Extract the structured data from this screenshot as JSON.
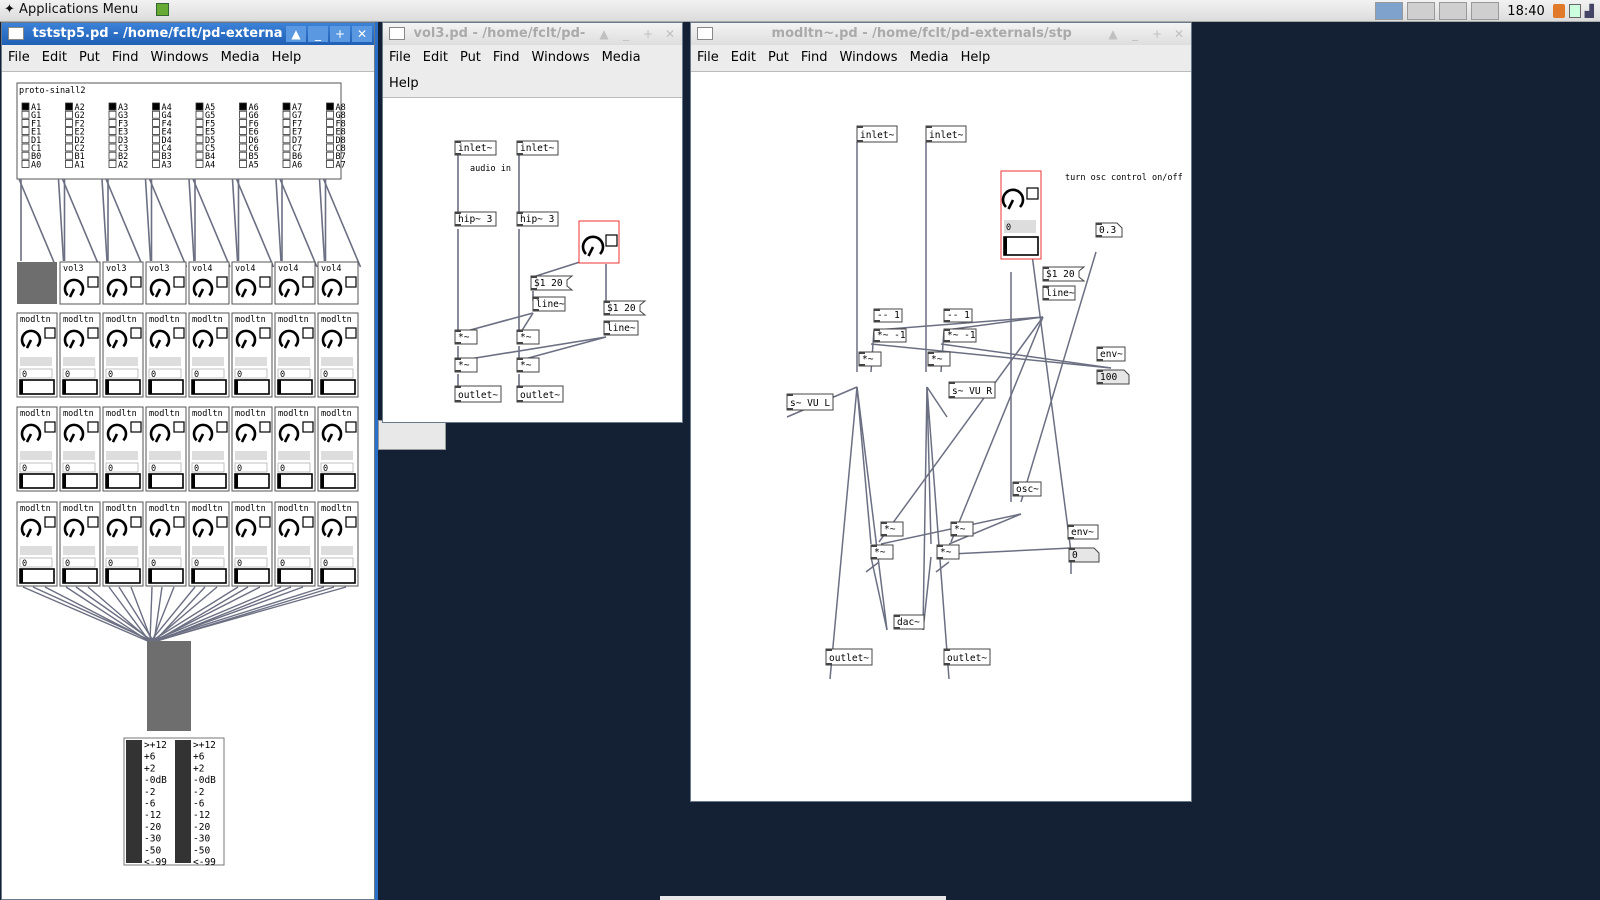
{
  "top_panel": {
    "apps_label": "Applications Menu",
    "clock": "18:40"
  },
  "menu_labels": [
    "File",
    "Edit",
    "Put",
    "Find",
    "Windows",
    "Media",
    "Help"
  ],
  "win_buttons": [
    "▲",
    "_",
    "+",
    "✕"
  ],
  "window1": {
    "title": "tststp5.pd  - /home/fclt/pd-externa",
    "proto_label": "proto-sinall2",
    "radio_columns": [
      [
        "A1",
        "G1",
        "F1",
        "E1",
        "D1",
        "C1",
        "B0",
        "A0"
      ],
      [
        "A2",
        "G2",
        "F2",
        "E2",
        "D2",
        "C2",
        "B1",
        "A1"
      ],
      [
        "A3",
        "G3",
        "F3",
        "E3",
        "D3",
        "C3",
        "B2",
        "A2"
      ],
      [
        "A4",
        "G4",
        "F4",
        "E4",
        "D4",
        "C4",
        "B3",
        "A3"
      ],
      [
        "A5",
        "G5",
        "F5",
        "E5",
        "D5",
        "C5",
        "B4",
        "A4"
      ],
      [
        "A6",
        "G6",
        "F6",
        "E6",
        "D6",
        "C6",
        "B5",
        "A5"
      ],
      [
        "A7",
        "G7",
        "F7",
        "E7",
        "D7",
        "C7",
        "B6",
        "A6"
      ],
      [
        "A8",
        "G8",
        "F8",
        "E8",
        "D8",
        "C8",
        "B7",
        "A7"
      ]
    ],
    "vol_labels": [
      "",
      "vol3",
      "vol3",
      "vol3",
      "vol4",
      "vol4",
      "vol4",
      "vol4"
    ],
    "modltn_label": "modltn",
    "number_value": "0",
    "vu_scale": [
      ">+12",
      "+6",
      "+2",
      "-0dB",
      "-2",
      "-6",
      "-12",
      "-20",
      "-30",
      "-50",
      "<-99"
    ]
  },
  "window2": {
    "title": "vol3.pd  - /home/fclt/pd-",
    "objects": {
      "inlet_l": "inlet~",
      "inlet_r": "inlet~",
      "audio_in": "audio in",
      "hip_l": "hip~ 3",
      "hip_r": "hip~ 3",
      "msg_a": "$1 20",
      "line_a": "line~",
      "msg_b": "$1 20",
      "line_b": "line~",
      "mul1": "*~",
      "mul2": "*~",
      "mul3": "*~",
      "mul4": "*~",
      "outlet_l": "outlet~",
      "outlet_r": "outlet~"
    }
  },
  "window3": {
    "title": "modltn~.pd  - /home/fclt/pd-externals/stp",
    "objects": {
      "inlet_l": "inlet~",
      "inlet_r": "inlet~",
      "comment": "turn osc control on/off",
      "num_03": "0.3",
      "numbox": "0",
      "msg": "$1 20",
      "line": "line~",
      "minus1a": "-- 1",
      "mulneg1a": "*~ -1",
      "minus1b": "-- 1",
      "mulneg1b": "*~ -1",
      "mula": "*~",
      "mulb": "*~",
      "send_l": "s~ VU L",
      "send_r": "s~ VU R",
      "env1": "env~",
      "num100": "100",
      "osc": "osc~",
      "mulc": "*~",
      "muld": "*~",
      "mule": "*~",
      "mulf": "*~",
      "env2": "env~",
      "num0": "0",
      "dac": "dac~",
      "outlet_l": "outlet~",
      "outlet_r": "outlet~"
    }
  }
}
